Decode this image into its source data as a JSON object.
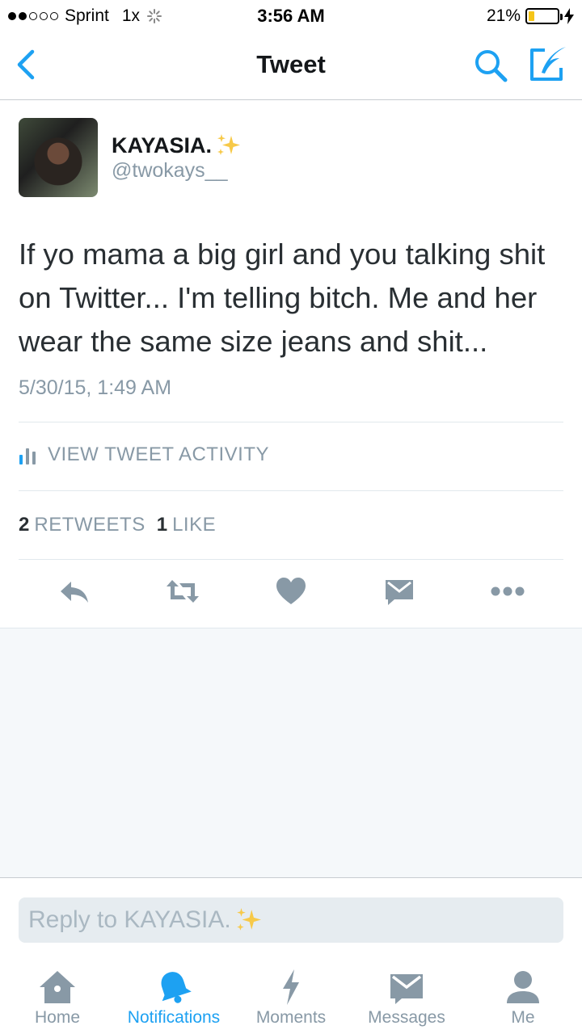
{
  "status_bar": {
    "carrier": "Sprint",
    "zoom": "1x",
    "time": "3:56 AM",
    "battery_percent": "21%",
    "battery_level": 0.21
  },
  "nav": {
    "title": "Tweet"
  },
  "tweet": {
    "author_name": "KAYASIA.",
    "author_handle": "@twokays__",
    "text": "If yo mama a big girl and you talking shit on Twitter... I'm telling bitch. Me and her wear the same size jeans and shit...",
    "timestamp": "5/30/15, 1:49 AM",
    "activity_label": "VIEW TWEET ACTIVITY",
    "retweets_count": "2",
    "retweets_label": "RETWEETS",
    "likes_count": "1",
    "likes_label": "LIKE"
  },
  "reply": {
    "placeholder": "Reply to KAYASIA."
  },
  "tabs": [
    {
      "label": "Home",
      "icon": "home-icon"
    },
    {
      "label": "Notifications",
      "icon": "bell-icon"
    },
    {
      "label": "Moments",
      "icon": "lightning-icon"
    },
    {
      "label": "Messages",
      "icon": "envelope-icon"
    },
    {
      "label": "Me",
      "icon": "person-icon"
    }
  ],
  "colors": {
    "accent": "#1da1f2",
    "icon_gray": "#8899a6",
    "battery": "#f5c518"
  }
}
